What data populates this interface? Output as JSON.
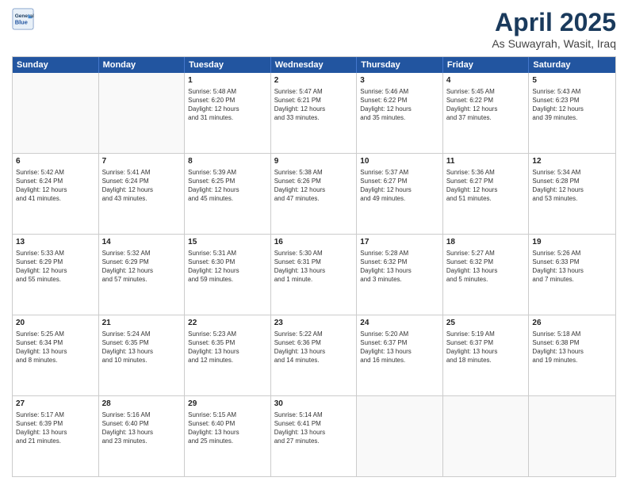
{
  "header": {
    "logo_line1": "General",
    "logo_line2": "Blue",
    "title": "April 2025",
    "subtitle": "As Suwayrah, Wasit, Iraq"
  },
  "days_of_week": [
    "Sunday",
    "Monday",
    "Tuesday",
    "Wednesday",
    "Thursday",
    "Friday",
    "Saturday"
  ],
  "weeks": [
    [
      {
        "day": "",
        "info": ""
      },
      {
        "day": "",
        "info": ""
      },
      {
        "day": "1",
        "info": "Sunrise: 5:48 AM\nSunset: 6:20 PM\nDaylight: 12 hours\nand 31 minutes."
      },
      {
        "day": "2",
        "info": "Sunrise: 5:47 AM\nSunset: 6:21 PM\nDaylight: 12 hours\nand 33 minutes."
      },
      {
        "day": "3",
        "info": "Sunrise: 5:46 AM\nSunset: 6:22 PM\nDaylight: 12 hours\nand 35 minutes."
      },
      {
        "day": "4",
        "info": "Sunrise: 5:45 AM\nSunset: 6:22 PM\nDaylight: 12 hours\nand 37 minutes."
      },
      {
        "day": "5",
        "info": "Sunrise: 5:43 AM\nSunset: 6:23 PM\nDaylight: 12 hours\nand 39 minutes."
      }
    ],
    [
      {
        "day": "6",
        "info": "Sunrise: 5:42 AM\nSunset: 6:24 PM\nDaylight: 12 hours\nand 41 minutes."
      },
      {
        "day": "7",
        "info": "Sunrise: 5:41 AM\nSunset: 6:24 PM\nDaylight: 12 hours\nand 43 minutes."
      },
      {
        "day": "8",
        "info": "Sunrise: 5:39 AM\nSunset: 6:25 PM\nDaylight: 12 hours\nand 45 minutes."
      },
      {
        "day": "9",
        "info": "Sunrise: 5:38 AM\nSunset: 6:26 PM\nDaylight: 12 hours\nand 47 minutes."
      },
      {
        "day": "10",
        "info": "Sunrise: 5:37 AM\nSunset: 6:27 PM\nDaylight: 12 hours\nand 49 minutes."
      },
      {
        "day": "11",
        "info": "Sunrise: 5:36 AM\nSunset: 6:27 PM\nDaylight: 12 hours\nand 51 minutes."
      },
      {
        "day": "12",
        "info": "Sunrise: 5:34 AM\nSunset: 6:28 PM\nDaylight: 12 hours\nand 53 minutes."
      }
    ],
    [
      {
        "day": "13",
        "info": "Sunrise: 5:33 AM\nSunset: 6:29 PM\nDaylight: 12 hours\nand 55 minutes."
      },
      {
        "day": "14",
        "info": "Sunrise: 5:32 AM\nSunset: 6:29 PM\nDaylight: 12 hours\nand 57 minutes."
      },
      {
        "day": "15",
        "info": "Sunrise: 5:31 AM\nSunset: 6:30 PM\nDaylight: 12 hours\nand 59 minutes."
      },
      {
        "day": "16",
        "info": "Sunrise: 5:30 AM\nSunset: 6:31 PM\nDaylight: 13 hours\nand 1 minute."
      },
      {
        "day": "17",
        "info": "Sunrise: 5:28 AM\nSunset: 6:32 PM\nDaylight: 13 hours\nand 3 minutes."
      },
      {
        "day": "18",
        "info": "Sunrise: 5:27 AM\nSunset: 6:32 PM\nDaylight: 13 hours\nand 5 minutes."
      },
      {
        "day": "19",
        "info": "Sunrise: 5:26 AM\nSunset: 6:33 PM\nDaylight: 13 hours\nand 7 minutes."
      }
    ],
    [
      {
        "day": "20",
        "info": "Sunrise: 5:25 AM\nSunset: 6:34 PM\nDaylight: 13 hours\nand 8 minutes."
      },
      {
        "day": "21",
        "info": "Sunrise: 5:24 AM\nSunset: 6:35 PM\nDaylight: 13 hours\nand 10 minutes."
      },
      {
        "day": "22",
        "info": "Sunrise: 5:23 AM\nSunset: 6:35 PM\nDaylight: 13 hours\nand 12 minutes."
      },
      {
        "day": "23",
        "info": "Sunrise: 5:22 AM\nSunset: 6:36 PM\nDaylight: 13 hours\nand 14 minutes."
      },
      {
        "day": "24",
        "info": "Sunrise: 5:20 AM\nSunset: 6:37 PM\nDaylight: 13 hours\nand 16 minutes."
      },
      {
        "day": "25",
        "info": "Sunrise: 5:19 AM\nSunset: 6:37 PM\nDaylight: 13 hours\nand 18 minutes."
      },
      {
        "day": "26",
        "info": "Sunrise: 5:18 AM\nSunset: 6:38 PM\nDaylight: 13 hours\nand 19 minutes."
      }
    ],
    [
      {
        "day": "27",
        "info": "Sunrise: 5:17 AM\nSunset: 6:39 PM\nDaylight: 13 hours\nand 21 minutes."
      },
      {
        "day": "28",
        "info": "Sunrise: 5:16 AM\nSunset: 6:40 PM\nDaylight: 13 hours\nand 23 minutes."
      },
      {
        "day": "29",
        "info": "Sunrise: 5:15 AM\nSunset: 6:40 PM\nDaylight: 13 hours\nand 25 minutes."
      },
      {
        "day": "30",
        "info": "Sunrise: 5:14 AM\nSunset: 6:41 PM\nDaylight: 13 hours\nand 27 minutes."
      },
      {
        "day": "",
        "info": ""
      },
      {
        "day": "",
        "info": ""
      },
      {
        "day": "",
        "info": ""
      }
    ]
  ]
}
